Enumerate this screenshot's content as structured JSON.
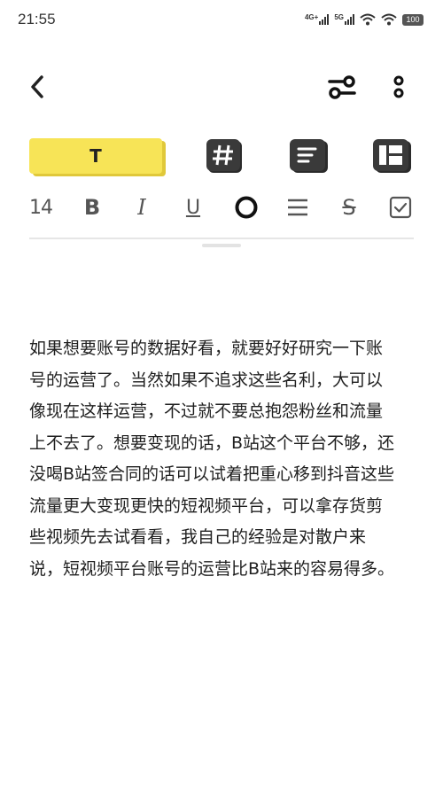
{
  "status_bar": {
    "time": "21:55",
    "network_1": "4G+",
    "network_2": "5G",
    "battery": "100"
  },
  "toolbar": {
    "back_icon": "chevron-left-icon",
    "settings_icon": "sliders-icon",
    "more_icon": "more-vertical-icon"
  },
  "modes": {
    "text_label": "T",
    "tag_icon": "hashtag-icon",
    "list_icon": "list-card-icon",
    "grid_icon": "layout-grid-icon",
    "active_color": "#f7e457"
  },
  "format": {
    "size": "14",
    "bold": "B",
    "italic": "I",
    "underline": "U",
    "strike": "S",
    "circle_icon": "text-color-icon",
    "align_icon": "align-lines-icon",
    "checkbox_icon": "checkbox-icon"
  },
  "note": {
    "lines": [
      "如果想要账号的数据好看，就要好好研究一下账",
      "号的运营了。当然如果不追求这些名利，大可以",
      "像现在这样运营，不过就不要总抱怨粉丝和流量",
      "上不去了。想要变现的话，B站这个平台不够，还",
      "没喝B站签合同的话可以试着把重心移到抖音这些",
      "流量更大变现更快的短视频平台，可以拿存货剪",
      "些视频先去试看看，我自己的经验是对散户来",
      "说，短视频平台账号的运营比B站来的容易得多。"
    ]
  }
}
